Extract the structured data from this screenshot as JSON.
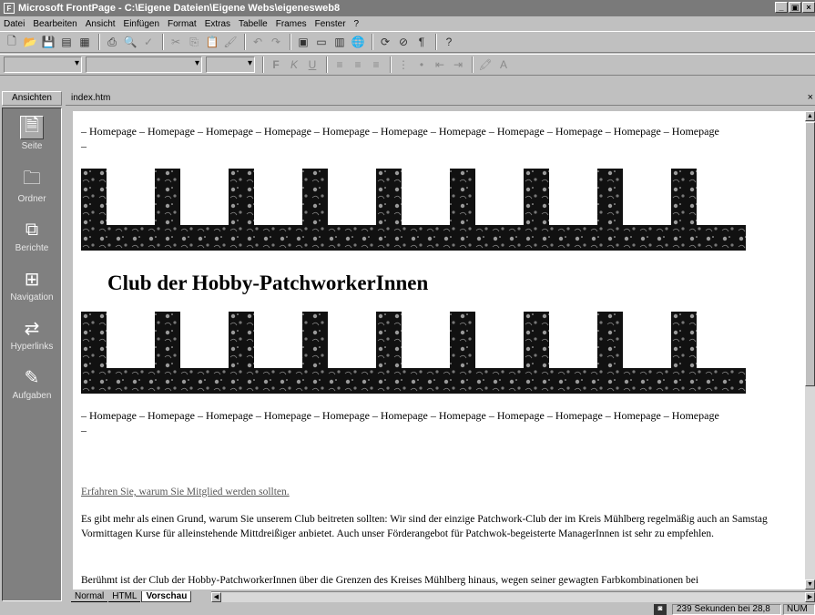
{
  "window": {
    "title": "Microsoft FrontPage - C:\\Eigene Dateien\\Eigene Webs\\eigenesweb8",
    "min_label": "_",
    "max_label": "▣",
    "close_label": "×"
  },
  "menu": [
    "Datei",
    "Bearbeiten",
    "Ansicht",
    "Einfügen",
    "Format",
    "Extras",
    "Tabelle",
    "Frames",
    "Fenster",
    "?"
  ],
  "views": {
    "header": "Ansichten",
    "items": [
      {
        "label": "Seite",
        "icon": "page-icon"
      },
      {
        "label": "Ordner",
        "icon": "folder-icon"
      },
      {
        "label": "Berichte",
        "icon": "reports-icon"
      },
      {
        "label": "Navigation",
        "icon": "navigation-icon"
      },
      {
        "label": "Hyperlinks",
        "icon": "hyperlinks-icon"
      },
      {
        "label": "Aufgaben",
        "icon": "tasks-icon"
      }
    ]
  },
  "document": {
    "tab_name": "index.htm",
    "nav_text": "– Homepage – Homepage – Homepage – Homepage – Homepage – Homepage – Homepage – Homepage – Homepage – Homepage – Homepage",
    "nav_tail": "–",
    "heading": "Club der Hobby-PatchworkerInnen",
    "link_text": "Erfahren Sie, warum Sie Mitglied werden sollten.",
    "paragraph1": "Es gibt mehr als einen Grund, warum Sie unserem Club beitreten sollten: Wir sind der einzige Patchwork-Club der im Kreis Mühlberg regelmäßig auch an Samstag Vormittagen Kurse für alleinstehende Mittdreißiger anbietet. Auch unser Förderangebot für Patchwok-begeisterte ManagerInnen ist sehr zu empfehlen.",
    "paragraph2": "Berühmt ist der Club der Hobby-PatchworkerInnen über die Grenzen des Kreises Mühlberg hinaus, wegen seiner gewagten Farbkombinationen bei"
  },
  "view_tabs": [
    "Normal",
    "HTML",
    "Vorschau"
  ],
  "active_view_tab": "Vorschau",
  "status": {
    "download_time": "239 Sekunden bei 28,8",
    "num": "NUM"
  },
  "colors": {
    "titlebar": "#7a7a7a",
    "chrome": "#c0c0c0",
    "views_panel": "#808080",
    "banner": "#111111"
  }
}
